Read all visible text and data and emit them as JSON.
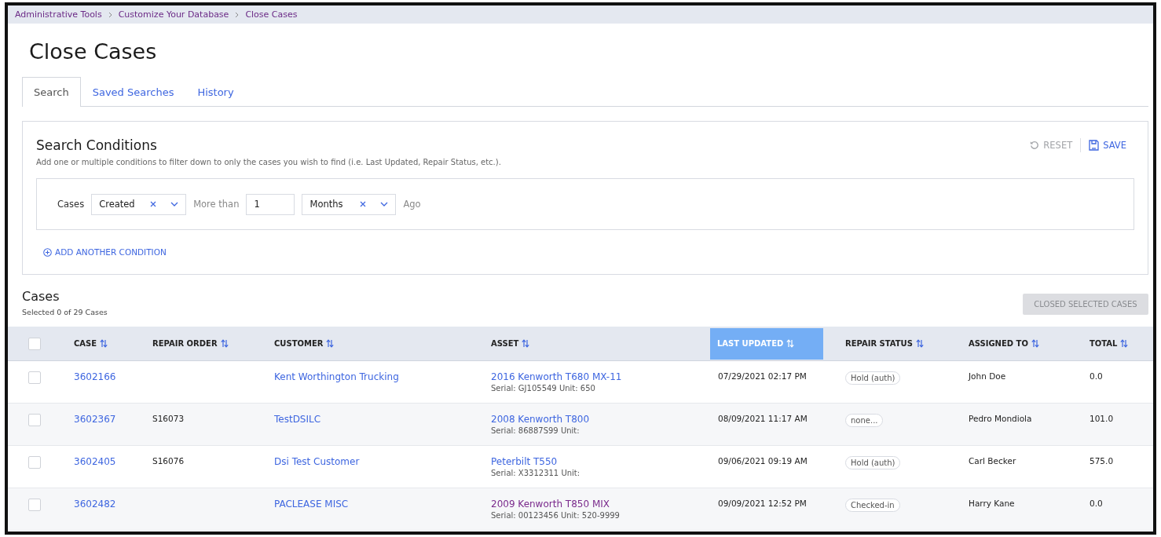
{
  "breadcrumb": [
    "Administrative Tools",
    "Customize Your Database",
    "Close Cases"
  ],
  "page_title": "Close Cases",
  "tabs": [
    {
      "label": "Search",
      "selected": true
    },
    {
      "label": "Saved Searches",
      "selected": false
    },
    {
      "label": "History",
      "selected": false
    }
  ],
  "search_conditions": {
    "title": "Search Conditions",
    "description": "Add one or multiple conditions to filter down to only the cases you wish to find (i.e. Last Updated, Repair Status, etc.).",
    "actions": [
      {
        "kind": "reset",
        "label": "RESET",
        "disabled": true
      },
      {
        "kind": "save",
        "label": "SAVE",
        "disabled": false
      }
    ],
    "condition": {
      "subject": "Cases",
      "field": {
        "value": "Created"
      },
      "comparator": "More than",
      "amount": {
        "value": "1"
      },
      "unit": {
        "value": "Months"
      },
      "suffix": "Ago"
    },
    "add_condition": "ADD ANOTHER CONDITION"
  },
  "cases": {
    "title": "Cases",
    "selection_summary": "Selected 0 of 29 Cases",
    "close_button": {
      "label": "CLOSED SELECTED CASES",
      "disabled": true
    },
    "table": {
      "select_all": {
        "checked": false
      },
      "columns": [
        {
          "kind": "case",
          "label": "CASE",
          "sorted": false
        },
        {
          "kind": "order",
          "label": "REPAIR ORDER",
          "sorted": false
        },
        {
          "kind": "customer",
          "label": "CUSTOMER",
          "sorted": false
        },
        {
          "kind": "asset",
          "label": "ASSET",
          "sorted": false
        },
        {
          "kind": "updated",
          "label": "LAST UPDATED",
          "sorted": true
        },
        {
          "kind": "status",
          "label": "REPAIR STATUS",
          "sorted": false
        },
        {
          "kind": "assignee",
          "label": "ASSIGNED TO",
          "sorted": false
        },
        {
          "kind": "total",
          "label": "TOTAL",
          "sorted": false
        }
      ],
      "rows": [
        {
          "checked": false,
          "case": "3602166",
          "customer": "Kent Worthington Trucking",
          "asset": {
            "name": "2016 Kenworth T680 MX-11",
            "detail": "Serial: GJ105549 Unit: 650",
            "visited": false
          },
          "last_updated": "07/29/2021 02:17 PM",
          "repair_status": "Hold (auth)",
          "assigned_to": "John Doe",
          "total": "0.0"
        },
        {
          "checked": false,
          "case": "3602367",
          "repair_order": "S16073",
          "customer": "TestDSILC",
          "asset": {
            "name": "2008 Kenworth T800",
            "detail": "Serial: 86887S99 Unit:",
            "visited": false
          },
          "last_updated": "08/09/2021 11:17 AM",
          "repair_status": "none...",
          "assigned_to": "Pedro Mondiola",
          "total": "101.0"
        },
        {
          "checked": false,
          "case": "3602405",
          "repair_order": "S16076",
          "customer": "Dsi Test Customer",
          "asset": {
            "name": "Peterbilt T550",
            "detail": "Serial: X3312311 Unit:",
            "visited": false
          },
          "last_updated": "09/06/2021 09:19 AM",
          "repair_status": "Hold (auth)",
          "assigned_to": "Carl Becker",
          "total": "575.0"
        },
        {
          "checked": false,
          "case": "3602482",
          "customer": "PACLEASE MISC",
          "asset": {
            "name": "2009 Kenworth T850 MIX",
            "detail": "Serial: 00123456 Unit: 520-9999",
            "visited": true
          },
          "last_updated": "09/09/2021 12:52 PM",
          "repair_status": "Checked-in",
          "assigned_to": "Harry Kane",
          "total": "0.0"
        }
      ]
    }
  }
}
